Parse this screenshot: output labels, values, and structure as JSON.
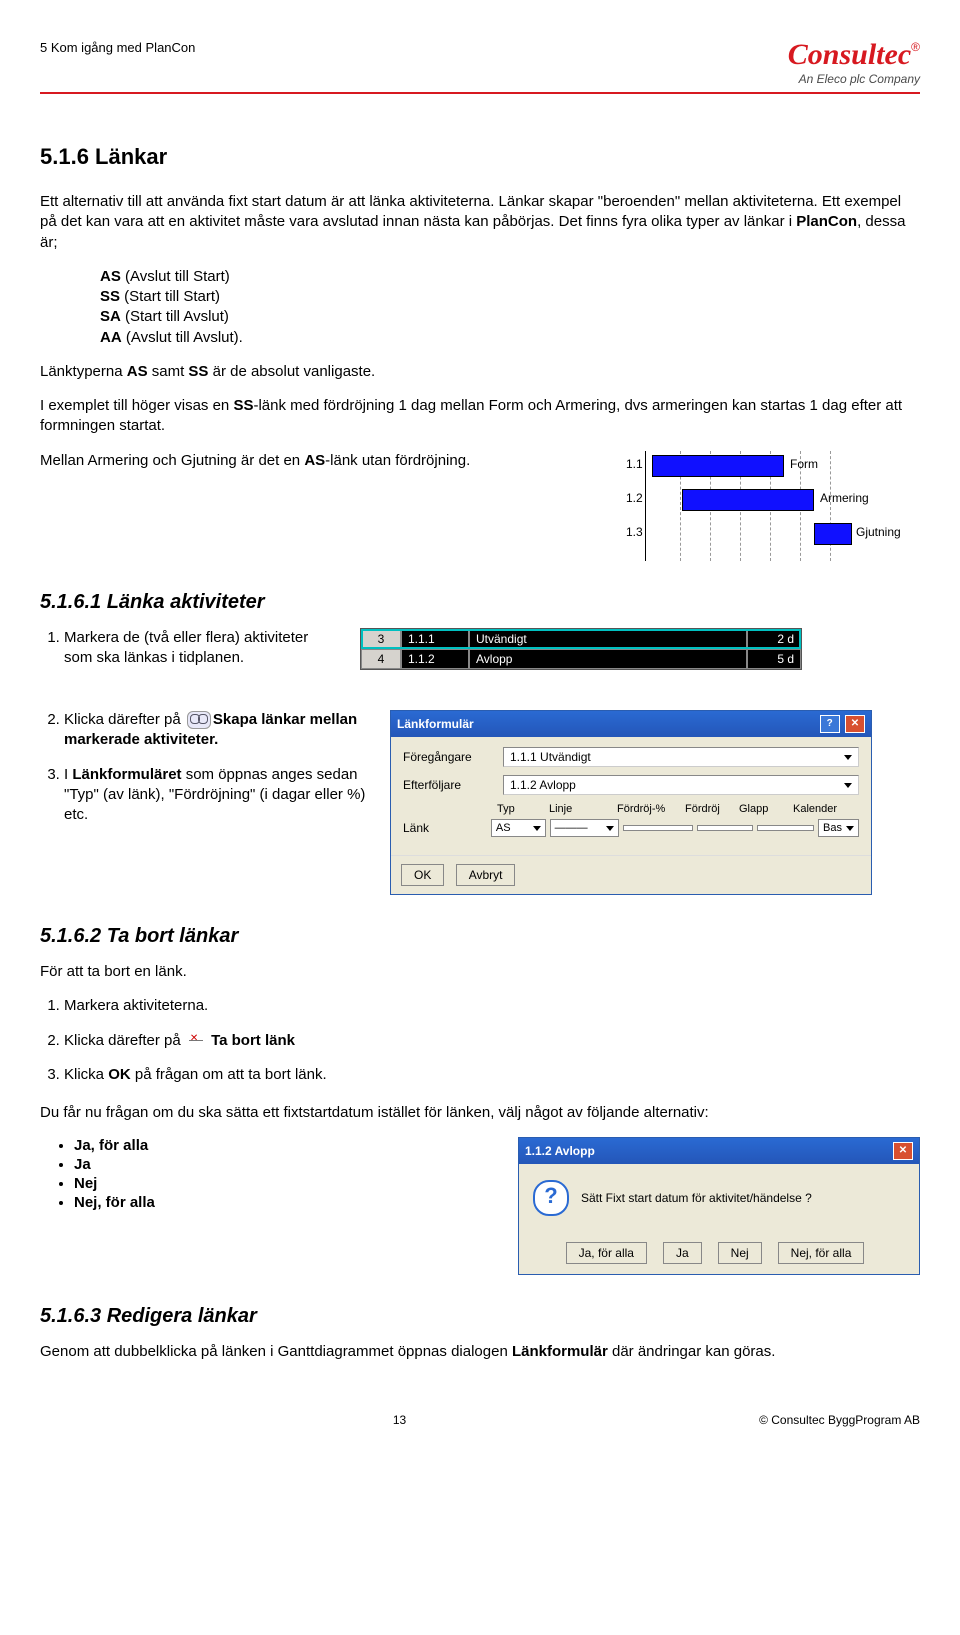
{
  "header": {
    "section": "5 Kom igång med PlanCon"
  },
  "logo": {
    "main": "Consultec",
    "reg": "®",
    "sub": "An Eleco plc Company"
  },
  "h516": "5.1.6  Länkar",
  "intro1": "Ett alternativ till att använda fixt start datum är att länka aktiviteterna. Länkar skapar \"beroenden\" mellan aktiviteterna. Ett exempel på det kan vara att en aktivitet måste vara avslutad innan nästa kan påbörjas. Det finns fyra olika typer av länkar i ",
  "intro1b": "PlanCon",
  "intro1c": ", dessa är;",
  "types": {
    "as": "AS",
    "as_txt": " (Avslut till Start)",
    "ss": "SS",
    "ss_txt": " (Start till Start)",
    "sa": "SA",
    "sa_txt": " (Start till Avslut)",
    "aa": "AA",
    "aa_txt": " (Avslut till Avslut)."
  },
  "p2a": "Länktyperna ",
  "p2b": "AS",
  "p2c": " samt ",
  "p2d": "SS",
  "p2e": " är de absolut vanligaste.",
  "p3a": "I exemplet till höger visas en ",
  "p3b": "SS",
  "p3c": "-länk med fördröjning 1 dag mellan Form och Armering, dvs armeringen kan startas 1 dag efter att formningen startat.",
  "p4a": "Mellan Armering och Gjutning är det en ",
  "p4b": "AS",
  "p4c": "-länk utan fördröjning.",
  "gantt": {
    "n1": "1.1",
    "l1": "Form",
    "n2": "1.2",
    "l2": "Armering",
    "n3": "1.3",
    "l3": "Gjutning"
  },
  "h5161": "5.1.6.1  Länka aktiviteter",
  "ol1": {
    "i1": "Markera de (två eller flera) aktiviteter som ska länkas i tidplanen.",
    "i2a": "Klicka därefter på ",
    "i2b": "Skapa länkar mellan markerade aktiviteter.",
    "i3a": "I ",
    "i3b": "Länkformuläret",
    "i3c": " som öppnas anges sedan \"Typ\" (av länk), \"Fördröjning\" (i dagar eller %) etc."
  },
  "table": {
    "r1": {
      "n": "3",
      "id": "1.1.1",
      "name": "Utvändigt",
      "d": "2 d"
    },
    "r2": {
      "n": "4",
      "id": "1.1.2",
      "name": "Avlopp",
      "d": "5 d"
    }
  },
  "dlg": {
    "title": "Länkformulär",
    "foreg": "Föregångare",
    "foreg_val": "1.1.1  Utvändigt",
    "efter": "Efterföljare",
    "efter_val": "1.1.2  Avlopp",
    "lank": "Länk",
    "hdr": {
      "typ": "Typ",
      "linje": "Linje",
      "fp": "Fördröj-%",
      "fd": "Fördröj",
      "gl": "Glapp",
      "ka": "Kalender"
    },
    "val": {
      "typ": "AS",
      "ka": "Bas"
    },
    "ok": "OK",
    "avbryt": "Avbryt"
  },
  "h5162": "5.1.6.2  Ta bort länkar",
  "p5": "För att ta bort en länk.",
  "ol2": {
    "i1": "Markera aktiviteterna.",
    "i2a": "Klicka därefter på ",
    "i2b": " Ta bort länk",
    "i3a": "Klicka ",
    "i3b": "OK",
    "i3c": " på frågan om att ta bort länk."
  },
  "p6": "Du får nu frågan om du ska sätta ett fixtstartdatum istället för länken, välj något av följande alternativ:",
  "opts": {
    "a": "Ja, för alla",
    "b": "Ja",
    "c": "Nej",
    "d": "Nej, för alla"
  },
  "msg": {
    "title": "1.1.2  Avlopp",
    "text": "Sätt Fixt start datum för aktivitet/händelse ?",
    "b1": "Ja, för alla",
    "b2": "Ja",
    "b3": "Nej",
    "b4": "Nej, för alla"
  },
  "h5163": "5.1.6.3  Redigera länkar",
  "p7a": "Genom att dubbelklicka på länken i Ganttdiagrammet öppnas dialogen ",
  "p7b": "Länkformulär",
  "p7c": " där ändringar kan göras.",
  "footer": {
    "page": "13",
    "copyright": "© Consultec ByggProgram AB"
  }
}
